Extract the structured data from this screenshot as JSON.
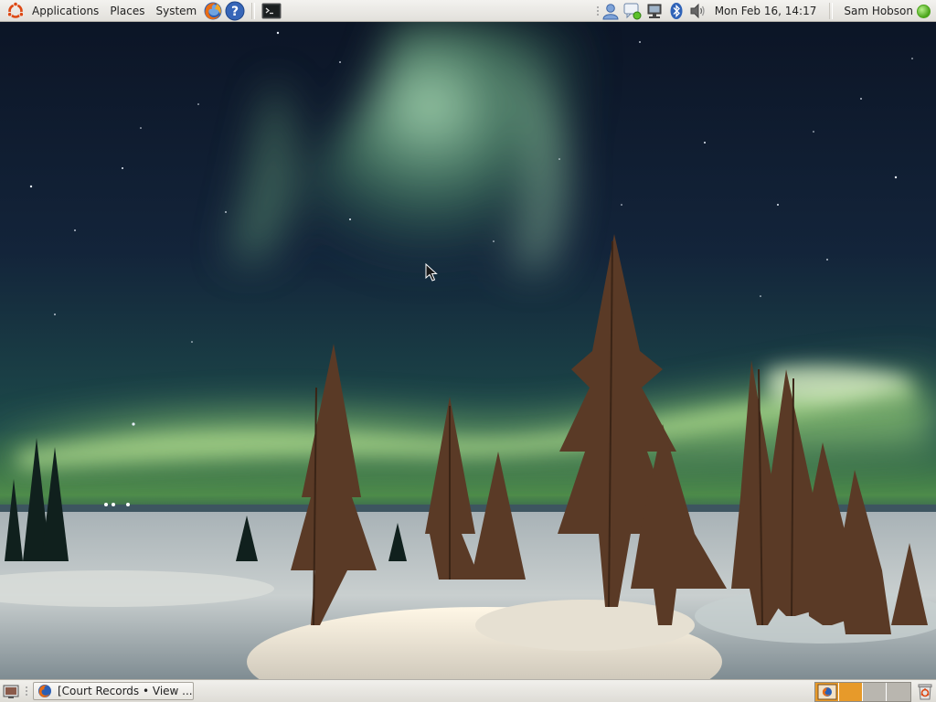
{
  "top_panel": {
    "menus": [
      {
        "label": "Applications"
      },
      {
        "label": "Places"
      },
      {
        "label": "System"
      }
    ],
    "launchers": [
      "firefox-icon",
      "help-icon",
      "terminal-icon"
    ],
    "tray_icons": [
      "user-switch-icon",
      "chat-status-icon",
      "network-icon",
      "bluetooth-icon",
      "volume-icon"
    ],
    "clock": "Mon Feb 16, 14:17",
    "user": "Sam Hobson",
    "status_color": "#4aa51a"
  },
  "taskbar": {
    "task_label": "[Court Records • View ..."
  },
  "workspace_switcher": {
    "count": 4,
    "active_index": 0,
    "colors": [
      "#e79a2a",
      "#e79a2a",
      "#b9b6af",
      "#b9b6af"
    ]
  }
}
